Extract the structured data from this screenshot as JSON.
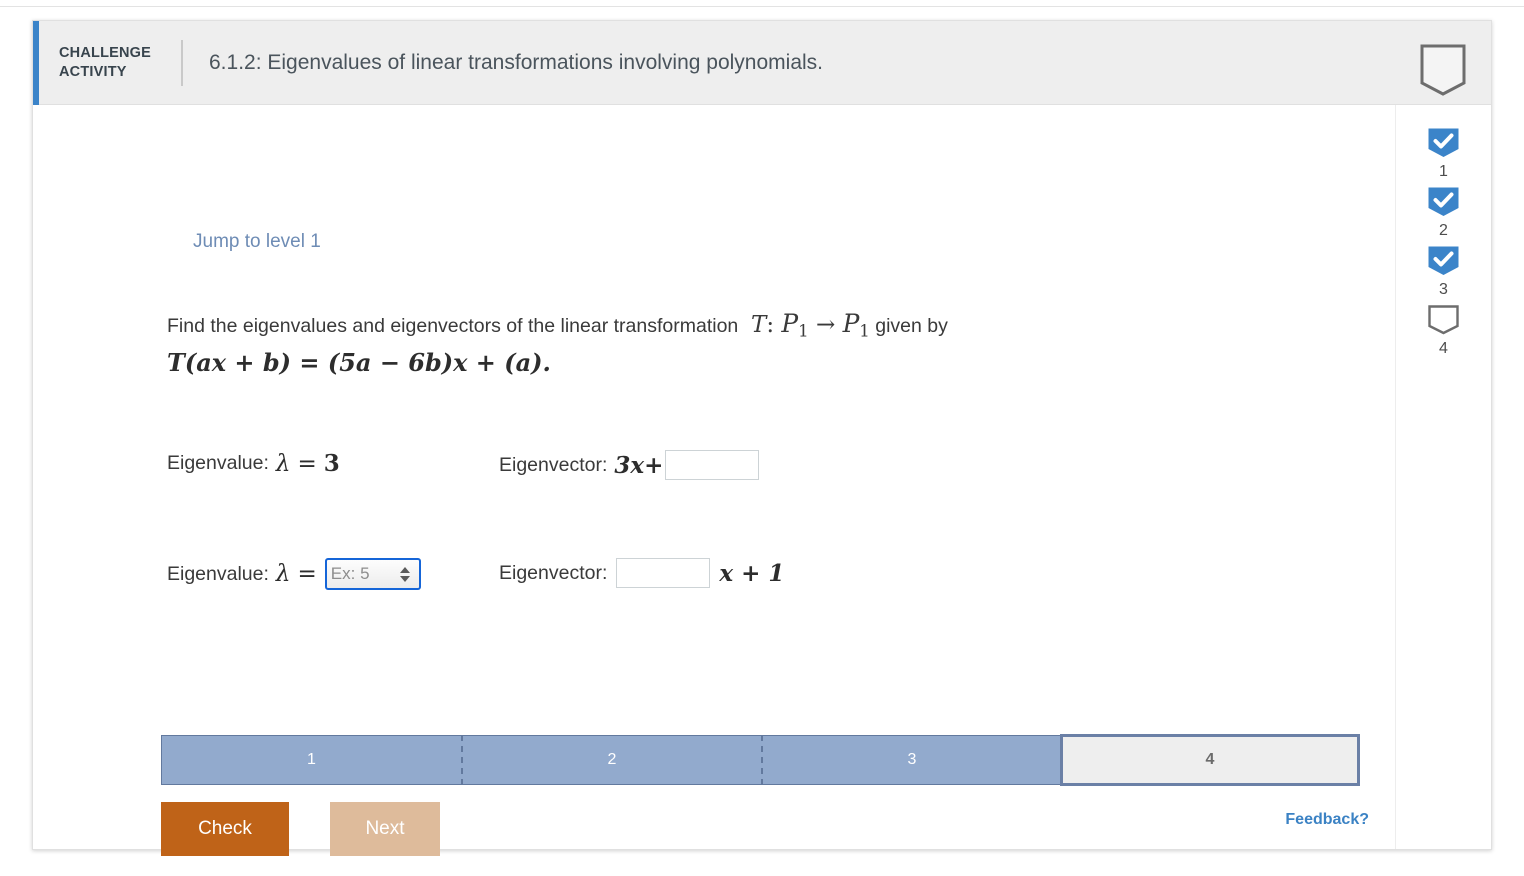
{
  "header": {
    "kicker_line1": "CHALLENGE",
    "kicker_line2": "ACTIVITY",
    "title": "6.1.2: Eigenvalues of linear transformations involving polynomials.",
    "badge_icon": "empty-banner-icon",
    "accent_color": "#3b84c9",
    "background_color": "#eeeeee"
  },
  "content": {
    "jump_link": "Jump to level 1",
    "question": {
      "lead": "Find the eigenvalues and eigenvectors of the linear transformation",
      "transformation": "T : P1 → P1",
      "transformation_T": "T",
      "colon": ":",
      "domain": "P",
      "domain_sub": "1",
      "arrow": "→",
      "codomain": "P",
      "codomain_sub": "1",
      "trailing": "given by",
      "formula": "T(ax + b) = (5a − 6b)x + (a)."
    },
    "rows": [
      {
        "eigenvalue_label": "Eigenvalue:",
        "lambda": "λ",
        "equals": "=",
        "eigenvalue_value": "3",
        "eigenvector_label": "Eigenvector:",
        "vector_prefix": "3x+",
        "vector_suffix": "",
        "input_value": "",
        "input_placeholder": ""
      },
      {
        "eigenvalue_label": "Eigenvalue:",
        "lambda": "λ",
        "equals": "=",
        "eigenvalue_value": "",
        "eigenvalue_placeholder": "Ex: 5",
        "eigenvector_label": "Eigenvector:",
        "vector_prefix": "",
        "vector_suffix": "x + 1",
        "input_value": "",
        "input_placeholder": ""
      }
    ]
  },
  "progress": {
    "segments": [
      {
        "label": "1",
        "state": "done"
      },
      {
        "label": "2",
        "state": "done"
      },
      {
        "label": "3",
        "state": "done"
      },
      {
        "label": "4",
        "state": "current"
      }
    ],
    "fill_color": "#92aacd",
    "current_color": "#eeeeee"
  },
  "buttons": {
    "check": "Check",
    "next": "Next",
    "check_color": "#bf6318",
    "next_color": "#debb9b"
  },
  "sidebar": {
    "steps": [
      {
        "number": "1",
        "state": "checked",
        "icon": "check-banner-icon"
      },
      {
        "number": "2",
        "state": "checked",
        "icon": "check-banner-icon"
      },
      {
        "number": "3",
        "state": "checked",
        "icon": "check-banner-icon"
      },
      {
        "number": "4",
        "state": "empty",
        "icon": "empty-banner-icon"
      }
    ],
    "checked_color": "#3b84c9"
  },
  "footer": {
    "feedback": "Feedback?",
    "feedback_color": "#3b82c4"
  }
}
